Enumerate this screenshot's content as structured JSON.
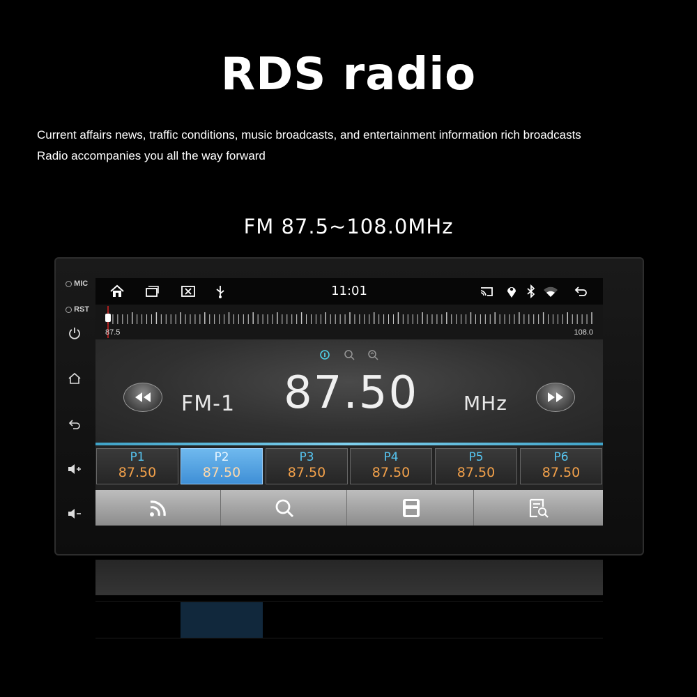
{
  "headline": "RDS radio",
  "subtitle": [
    "Current affairs news, traffic conditions, music broadcasts, and entertainment information rich broadcasts",
    "Radio accompanies you all the way forward"
  ],
  "range_text": "FM 87.5~108.0MHz",
  "device": {
    "mic_label": "MIC",
    "rst_label": "RST"
  },
  "statusbar": {
    "time": "11:01"
  },
  "tuner": {
    "min_label": "87.5",
    "max_label": "108.0",
    "position": 0.0
  },
  "radio": {
    "band": "FM-1",
    "frequency": "87.50",
    "unit": "MHz"
  },
  "presets": [
    {
      "name": "P1",
      "freq": "87.50"
    },
    {
      "name": "P2",
      "freq": "87.50"
    },
    {
      "name": "P3",
      "freq": "87.50"
    },
    {
      "name": "P4",
      "freq": "87.50"
    },
    {
      "name": "P5",
      "freq": "87.50"
    },
    {
      "name": "P6",
      "freq": "87.50"
    }
  ],
  "selected_preset": "P2",
  "toolbar": [
    "rds-icon",
    "search-icon",
    "save-icon",
    "list-search-icon"
  ],
  "colors": {
    "accent_blue": "#3f8fd6",
    "preset_label": "#56c4f0",
    "preset_freq": "#f3a14a",
    "tuner_marker": "#d22"
  }
}
